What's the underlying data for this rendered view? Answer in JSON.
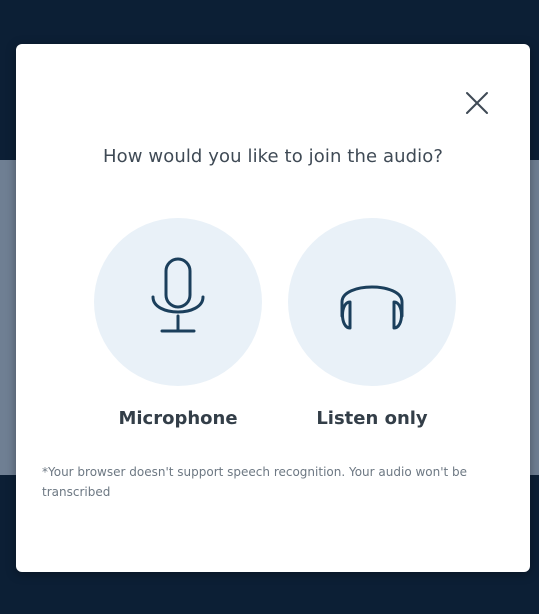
{
  "dialog": {
    "title": "How would you like to join the audio?",
    "close_icon": "close-icon",
    "options": [
      {
        "label": "Microphone",
        "icon": "microphone-icon"
      },
      {
        "label": "Listen only",
        "icon": "headphones-icon"
      }
    ],
    "note": "*Your browser doesn't support speech recognition. Your audio won't be transcribed"
  },
  "colors": {
    "overlay_dark": "#0c1f35",
    "overlay_mid": "#6f7f93",
    "modal_bg": "#ffffff",
    "option_circle": "#e9f1f8",
    "icon_stroke": "#1b3f5c",
    "title_text": "#3f4a55",
    "note_text": "#6d7883"
  }
}
